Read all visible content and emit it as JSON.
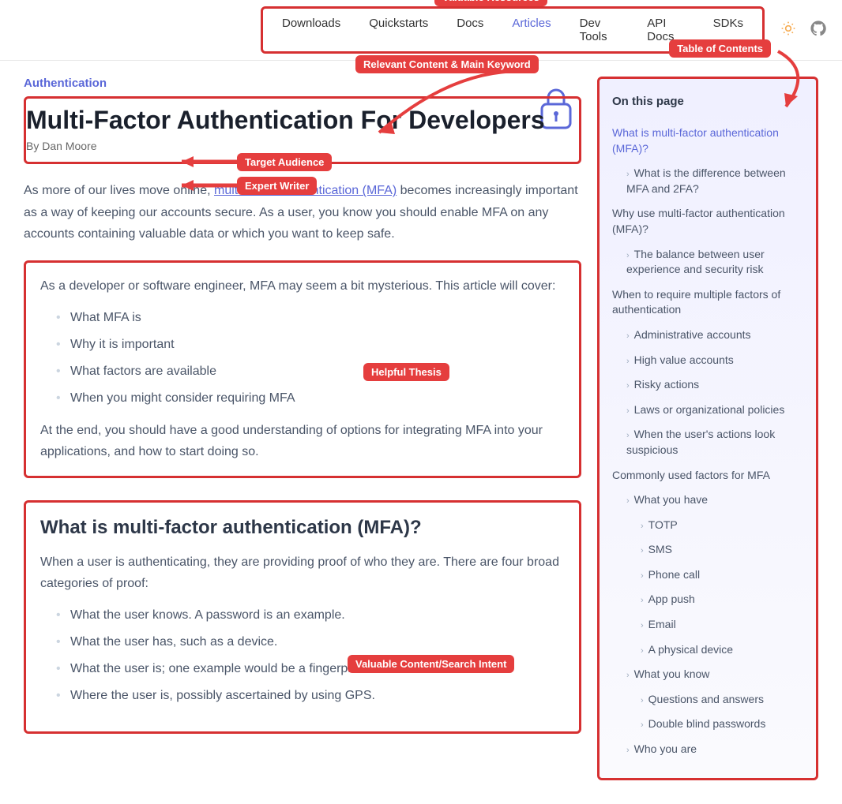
{
  "nav": {
    "items": [
      "Downloads",
      "Quickstarts",
      "Docs",
      "Articles",
      "Dev Tools",
      "API Docs",
      "SDKs"
    ],
    "active_index": 3
  },
  "breadcrumb": "Authentication",
  "title": "Multi-Factor Authentication For Developers",
  "byline": "By Dan Moore",
  "intro": {
    "before_link": "As more of our lives move online, ",
    "link_text": "multi-factor authentication (MFA)",
    "after_link": " becomes increasingly important as a way of keeping our accounts secure. As a user, you know you should enable MFA on any accounts containing valuable data or which you want to keep safe."
  },
  "thesis": {
    "lead": "As a developer or software engineer, MFA may seem a bit mysterious. This article will cover:",
    "bullets": [
      "What MFA is",
      "Why it is important",
      "What factors are available",
      "When you might consider requiring MFA"
    ],
    "closing": "At the end, you should have a good understanding of options for integrating MFA into your applications, and how to start doing so."
  },
  "section": {
    "heading": "What is multi-factor authentication (MFA)?",
    "para": "When a user is authenticating, they are providing proof of who they are. There are four broad categories of proof:",
    "bullets": [
      "What the user knows. A password is an example.",
      "What the user has, such as a device.",
      "What the user is; one example would be a fingerprint.",
      "Where the user is, possibly ascertained by using GPS."
    ]
  },
  "toc": {
    "title": "On this page",
    "items": [
      {
        "label": "What is multi-factor authentication (MFA)?",
        "level": 0,
        "active": true
      },
      {
        "label": "What is the difference between MFA and 2FA?",
        "level": 1
      },
      {
        "label": "Why use multi-factor authentication (MFA)?",
        "level": 0
      },
      {
        "label": "The balance between user experience and security risk",
        "level": 1
      },
      {
        "label": "When to require multiple factors of authentication",
        "level": 0
      },
      {
        "label": "Administrative accounts",
        "level": 1
      },
      {
        "label": "High value accounts",
        "level": 1
      },
      {
        "label": "Risky actions",
        "level": 1
      },
      {
        "label": "Laws or organizational policies",
        "level": 1
      },
      {
        "label": "When the user's actions look suspicious",
        "level": 1
      },
      {
        "label": "Commonly used factors for MFA",
        "level": 0
      },
      {
        "label": "What you have",
        "level": 1
      },
      {
        "label": "TOTP",
        "level": 2
      },
      {
        "label": "SMS",
        "level": 2
      },
      {
        "label": "Phone call",
        "level": 2
      },
      {
        "label": "App push",
        "level": 2
      },
      {
        "label": "Email",
        "level": 2
      },
      {
        "label": "A physical device",
        "level": 2
      },
      {
        "label": "What you know",
        "level": 1
      },
      {
        "label": "Questions and answers",
        "level": 2
      },
      {
        "label": "Double blind passwords",
        "level": 2
      },
      {
        "label": "Who you are",
        "level": 1
      }
    ]
  },
  "annotations": {
    "resources": "Valuable Resources",
    "toc": "Table of Contents",
    "keyword": "Relevant Content & Main Keyword",
    "audience": "Target Audience",
    "writer": "Expert Writer",
    "thesis": "Helpful Thesis",
    "content": "Valuable Content/Search Intent"
  }
}
